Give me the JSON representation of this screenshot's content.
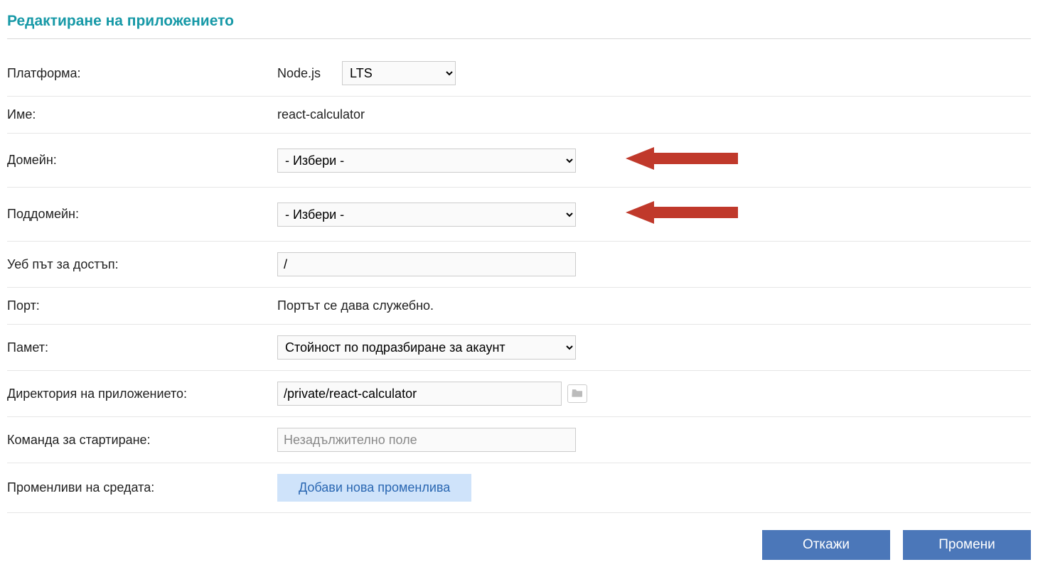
{
  "title": "Редактиране на приложението",
  "labels": {
    "platform": "Платформа:",
    "name": "Име:",
    "domain": "Домейн:",
    "subdomain": "Поддомейн:",
    "webpath": "Уеб път за достъп:",
    "port": "Порт:",
    "memory": "Памет:",
    "appdir": "Директория на приложението:",
    "startcmd": "Команда за стартиране:",
    "envvars": "Променливи на средата:"
  },
  "values": {
    "platform_name": "Node.js",
    "platform_version_selected": "LTS",
    "name": "react-calculator",
    "domain_selected": "- Избери -",
    "subdomain_selected": "- Избери -",
    "webpath": "/",
    "port_text": "Портът се дава служебно.",
    "memory_selected": "Стойност по подразбиране за акаунт",
    "appdir": "/private/react-calculator",
    "startcmd_placeholder": "Незадължително поле",
    "addvar_label": "Добави нова променлива"
  },
  "buttons": {
    "cancel": "Откажи",
    "submit": "Промени"
  }
}
